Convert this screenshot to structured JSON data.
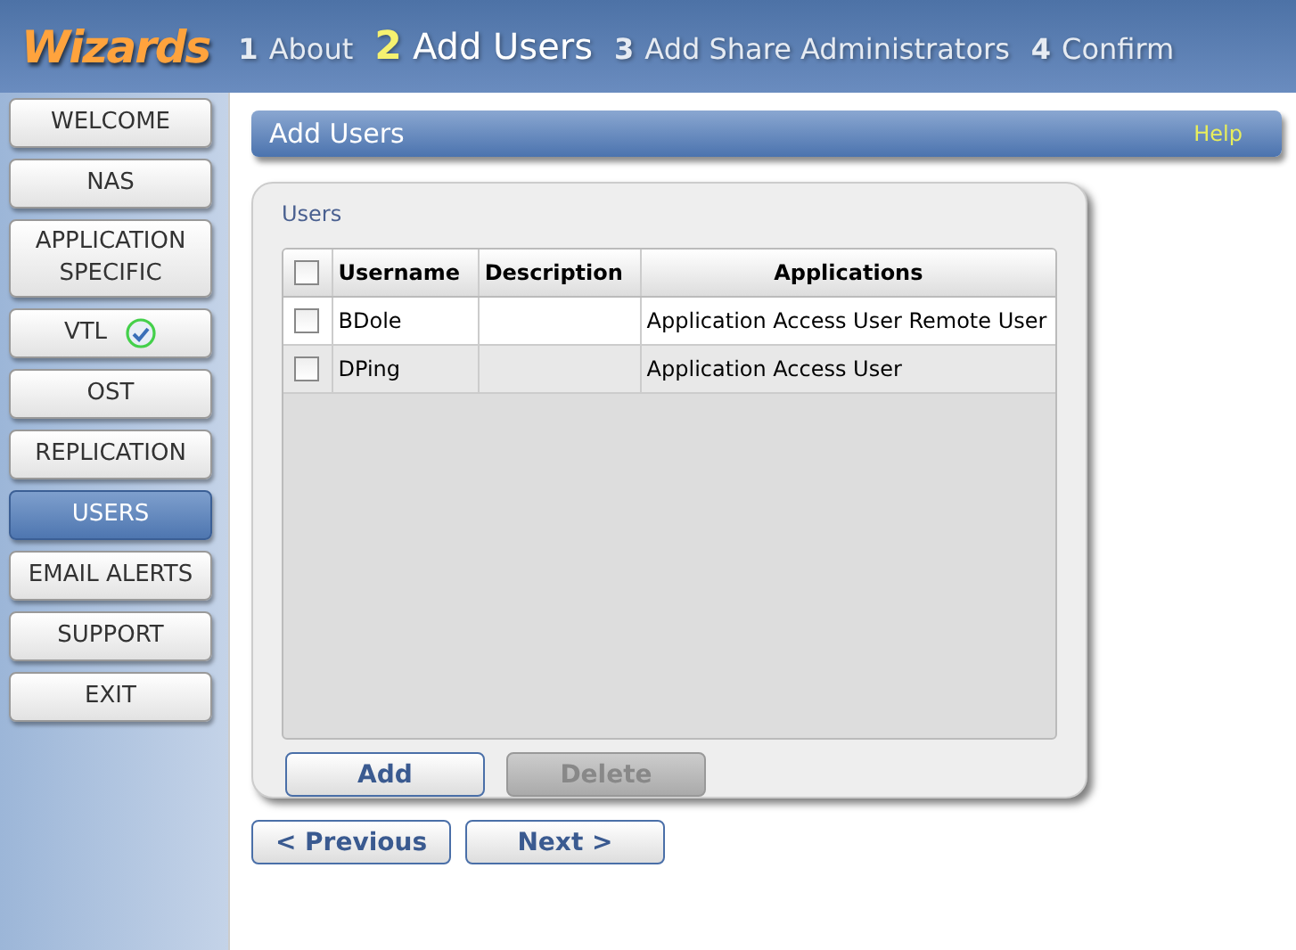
{
  "header": {
    "logo": "Wizards",
    "steps": [
      {
        "number": "1",
        "label": "About",
        "selected": false
      },
      {
        "number": "2",
        "label": "Add Users",
        "selected": true
      },
      {
        "number": "3",
        "label": "Add Share Administrators",
        "selected": false
      },
      {
        "number": "4",
        "label": "Confirm",
        "selected": false
      }
    ]
  },
  "sidebar": {
    "items": [
      {
        "label": "WELCOME",
        "selected": false,
        "done": false
      },
      {
        "label": "NAS",
        "selected": false,
        "done": false
      },
      {
        "label": "APPLICATION SPECIFIC",
        "selected": false,
        "done": false
      },
      {
        "label": "VTL",
        "selected": false,
        "done": true
      },
      {
        "label": "OST",
        "selected": false,
        "done": false
      },
      {
        "label": "REPLICATION",
        "selected": false,
        "done": false
      },
      {
        "label": "USERS",
        "selected": true,
        "done": false
      },
      {
        "label": "EMAIL ALERTS",
        "selected": false,
        "done": false
      },
      {
        "label": "SUPPORT",
        "selected": false,
        "done": false
      },
      {
        "label": "EXIT",
        "selected": false,
        "done": false
      }
    ]
  },
  "panel": {
    "title": "Add Users",
    "help": "Help"
  },
  "users": {
    "legend": "Users",
    "select_all_checked": false,
    "columns": [
      "Username",
      "Description",
      "Applications"
    ],
    "rows": [
      {
        "checked": false,
        "cells": [
          "BDole",
          "",
          "Application Access User Remote User"
        ]
      },
      {
        "checked": false,
        "cells": [
          "DPing",
          "",
          "Application Access User"
        ]
      }
    ],
    "buttons": [
      {
        "label": "Add",
        "disabled": false
      },
      {
        "label": "Delete",
        "disabled": true
      }
    ]
  },
  "nav": [
    {
      "label": "< Previous",
      "disabled": false
    },
    {
      "label": "Next >",
      "disabled": false
    }
  ]
}
